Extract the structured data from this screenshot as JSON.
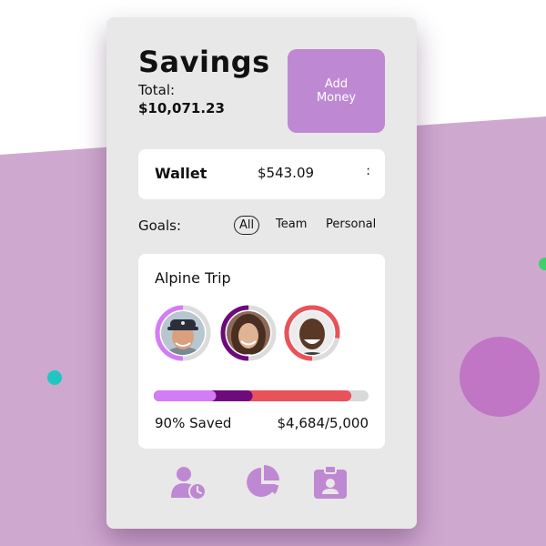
{
  "colors": {
    "accent": "#bf88d3",
    "background_shape": "#cfa8d0",
    "progress_light": "#d47cf5",
    "progress_dark": "#6e0a7c",
    "progress_red": "#e8525a",
    "progress_track": "#d9d9d9"
  },
  "savings": {
    "title": "Savings",
    "total_label": "Total:",
    "total_value": "$10,071.23",
    "add_button": "Add\nMoney"
  },
  "wallet": {
    "label": "Wallet",
    "amount": "$543.09",
    "menu": ":"
  },
  "goals": {
    "label": "Goals:",
    "tabs": [
      {
        "label": "All",
        "active": true
      },
      {
        "label": "Team",
        "active": false
      },
      {
        "label": "Personal",
        "active": false
      }
    ]
  },
  "goal": {
    "name": "Alpine Trip",
    "saved_label": "90% Saved",
    "amount": "$4,684/5,000",
    "contributions": [
      0.29,
      0.17,
      0.46
    ],
    "avatars": [
      {
        "icon": "avatar-man-cap",
        "ring_fraction": 0.5,
        "ring_color": "#d47cf5"
      },
      {
        "icon": "avatar-woman",
        "ring_fraction": 0.5,
        "ring_color": "#6e0a7c"
      },
      {
        "icon": "avatar-man-smiling",
        "ring_fraction": 0.78,
        "ring_color": "#e8525a"
      }
    ]
  },
  "nav": {
    "icons": [
      "user-clock-icon",
      "pie-chart-icon",
      "id-badge-icon"
    ]
  }
}
